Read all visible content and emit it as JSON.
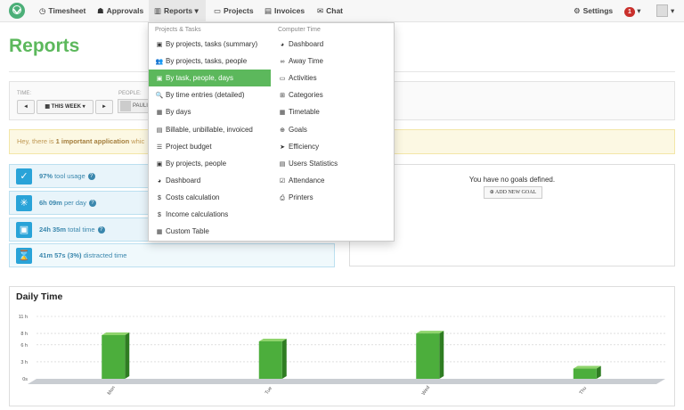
{
  "nav": {
    "items": [
      {
        "label": "Timesheet",
        "icon": "◷"
      },
      {
        "label": "Approvals",
        "icon": "☗"
      },
      {
        "label": "Reports",
        "icon": "▥",
        "caret": "▾"
      },
      {
        "label": "Projects",
        "icon": "▭"
      },
      {
        "label": "Invoices",
        "icon": "▤"
      },
      {
        "label": "Chat",
        "icon": "✉"
      }
    ],
    "settings": {
      "label": "Settings",
      "icon": "⚙"
    },
    "notifications_count": "1",
    "caret": "▾"
  },
  "page": {
    "title": "Reports",
    "time_label": "TIME:",
    "people_label": "PEOPLE:",
    "prev_label": "◄",
    "next_label": "►",
    "range_label": "▦ THIS WEEK ▾",
    "person_name": "PAULI"
  },
  "alert": {
    "prefix": "Hey, there is ",
    "highlight": "1 important application",
    "suffix": " whic"
  },
  "stats": [
    {
      "value": "97%",
      "text": " tool usage",
      "icon": "✓",
      "help": "?"
    },
    {
      "value": "6h 09m",
      "text": " per day",
      "icon": "✳",
      "help": "?"
    },
    {
      "value": "24h 35m",
      "text": " total time",
      "icon": "▣",
      "help": "?"
    },
    {
      "value": "41m 57s (3%)",
      "text": " distracted time",
      "icon": "⌛",
      "help": ""
    }
  ],
  "goals": {
    "message": "You have no goals defined.",
    "add_label": "⊕ ADD NEW GOAL"
  },
  "menu": {
    "projects_heading": "Projects & Tasks",
    "computer_heading": "Computer Time",
    "projects": [
      {
        "label": "By projects, tasks (summary)",
        "icon": "▣"
      },
      {
        "label": "By projects, tasks, people",
        "icon": "👥"
      },
      {
        "label": "By task, people, days",
        "icon": "▣",
        "active": true
      },
      {
        "label": "By time entries (detailed)",
        "icon": "🔍"
      },
      {
        "label": "By days",
        "icon": "▦"
      },
      {
        "label": "Billable, unbillable, invoiced",
        "icon": "▤"
      },
      {
        "label": "Project budget",
        "icon": "☰"
      },
      {
        "label": "By projects, people",
        "icon": "▣"
      },
      {
        "label": "Dashboard",
        "icon": "◕"
      },
      {
        "label": "Costs calculation",
        "icon": "$"
      },
      {
        "label": "Income calculations",
        "icon": "$"
      },
      {
        "label": "Custom Table",
        "icon": "▦"
      }
    ],
    "computer": [
      {
        "label": "Dashboard",
        "icon": "◕"
      },
      {
        "label": "Away Time",
        "icon": "∞"
      },
      {
        "label": "Activities",
        "icon": "▭"
      },
      {
        "label": "Categories",
        "icon": "⊞"
      },
      {
        "label": "Timetable",
        "icon": "▦"
      },
      {
        "label": "Goals",
        "icon": "⊕"
      },
      {
        "label": "Efficiency",
        "icon": "➤"
      },
      {
        "label": "Users Statistics",
        "icon": "▤"
      },
      {
        "label": "Attendance",
        "icon": "☑"
      },
      {
        "label": "Printers",
        "icon": "⎙"
      }
    ]
  },
  "chart_data": {
    "type": "bar",
    "title": "Daily Time",
    "categories": [
      "Mon",
      "Tue",
      "Wed",
      "Thu"
    ],
    "values": [
      7.7,
      6.6,
      8.0,
      1.8
    ],
    "yticks": [
      "0s",
      "3 h",
      "6 h",
      "8 h",
      "11 h"
    ],
    "ytick_values": [
      0,
      3,
      6,
      8,
      11
    ],
    "ylim": [
      0,
      11
    ],
    "grid": true,
    "color": "#4cae3c"
  }
}
